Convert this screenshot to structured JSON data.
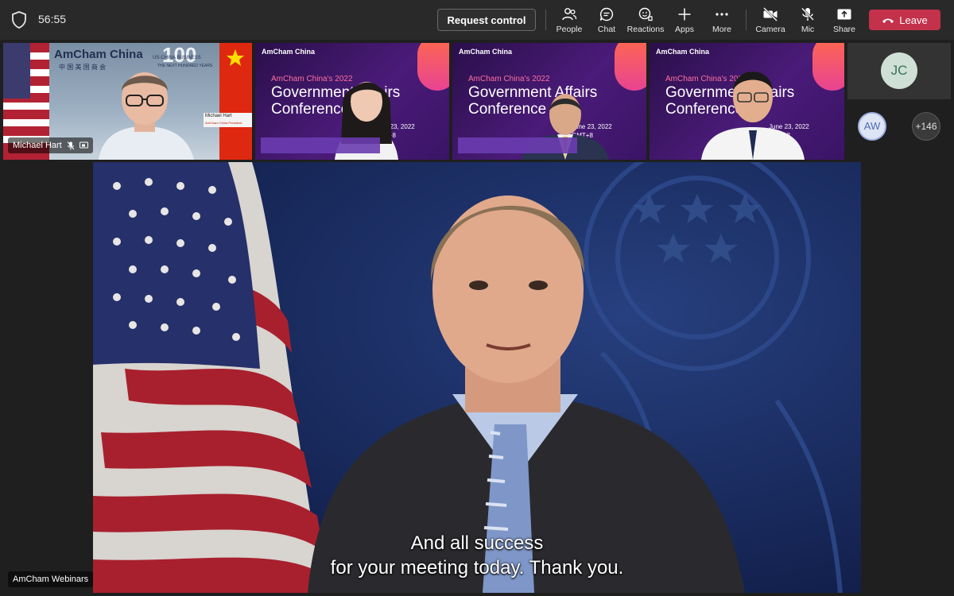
{
  "topbar": {
    "timer": "56:55",
    "request_control_label": "Request control",
    "tools": [
      {
        "label": "People",
        "icon": "people-icon"
      },
      {
        "label": "Chat",
        "icon": "chat-icon"
      },
      {
        "label": "Reactions",
        "icon": "reactions-icon"
      },
      {
        "label": "Apps",
        "icon": "plus-icon"
      },
      {
        "label": "More",
        "icon": "more-icon"
      },
      {
        "label": "Camera",
        "icon": "camera-icon"
      },
      {
        "label": "Mic",
        "icon": "mic-off-icon"
      },
      {
        "label": "Share",
        "icon": "share-icon"
      }
    ],
    "leave_label": "Leave",
    "leave_color": "#c4314b"
  },
  "participants": {
    "tile1": {
      "name": "Michael Hart",
      "backdrop_brand": "AmCham China",
      "backdrop_chinese": "中 国 美 国 商 会",
      "backdrop_100": "100",
      "backdrop_tag1": "US-CHINA BUSINESS",
      "backdrop_tag2": "THE NEXT HUNDRED YEARS",
      "nameplate_name": "Michael Hart",
      "nameplate_title": "AmCham China President"
    },
    "conference": {
      "brand": "AmCham China",
      "brand_chinese": "中 国 美 国 商 会",
      "subtitle": "AmCham China's 2022",
      "title_line1": "Government Affairs",
      "title_line2": "Conference",
      "date_line1": "June 23, 2022",
      "date_line2": "GMT+8"
    },
    "avatar_jc": "JC",
    "avatar_aw": "AW",
    "overflow_count": "+146"
  },
  "stage": {
    "caption_line1": "And all success",
    "caption_line2": "for your meeting today. Thank you.",
    "label": "AmCham Webinars"
  }
}
